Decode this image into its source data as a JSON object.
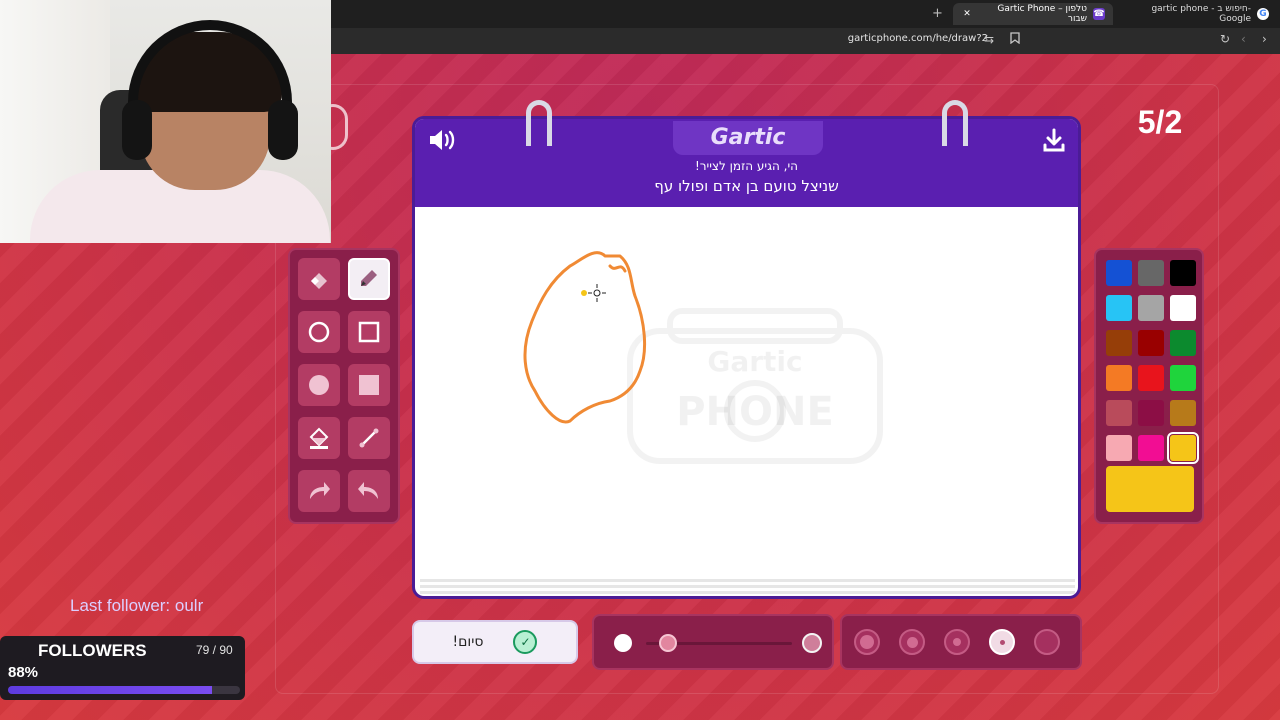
{
  "browser": {
    "tabs": [
      {
        "label": "Gartic Phone – טלפון שבור",
        "active": true
      },
      {
        "label": "gartic phone - חיפוש ב-Google",
        "active": false
      }
    ],
    "url": "garticphone.com/he/draw?2",
    "new_tab": "+"
  },
  "game": {
    "logo": "Gartic",
    "watermark": "Gartic PHONE",
    "subtitle": "הי, הגיע הזמן לצייר!",
    "prompt": "שניצל טועם בן אדם ופולו עף",
    "round_counter": "5/2",
    "done_label": "סיום!",
    "current_color": "#f5c518",
    "palette": [
      "#1451d4",
      "#676767",
      "#000000",
      "#27c4f5",
      "#a5a5a5",
      "#ffffff",
      "#963e08",
      "#990000",
      "#0c8a2e",
      "#f47a24",
      "#e8141c",
      "#1fd43c",
      "#b94b5b",
      "#8c0e45",
      "#b77a1a",
      "#f7a9b2",
      "#f20d93",
      "#f5c518"
    ],
    "selected_swatch_index": 17,
    "opacity_fraction": 0.1,
    "size_options": 5,
    "selected_size_index": 3
  },
  "overlay": {
    "last_follower": "Last follower: oulr",
    "followers_label": "FOLLOWERS",
    "followers_count": "79 / 90",
    "followers_percent": "88%",
    "followers_fraction": 0.88
  },
  "colors": {
    "stroke": "#f08a34",
    "accent_purple": "#5a1fb0"
  }
}
